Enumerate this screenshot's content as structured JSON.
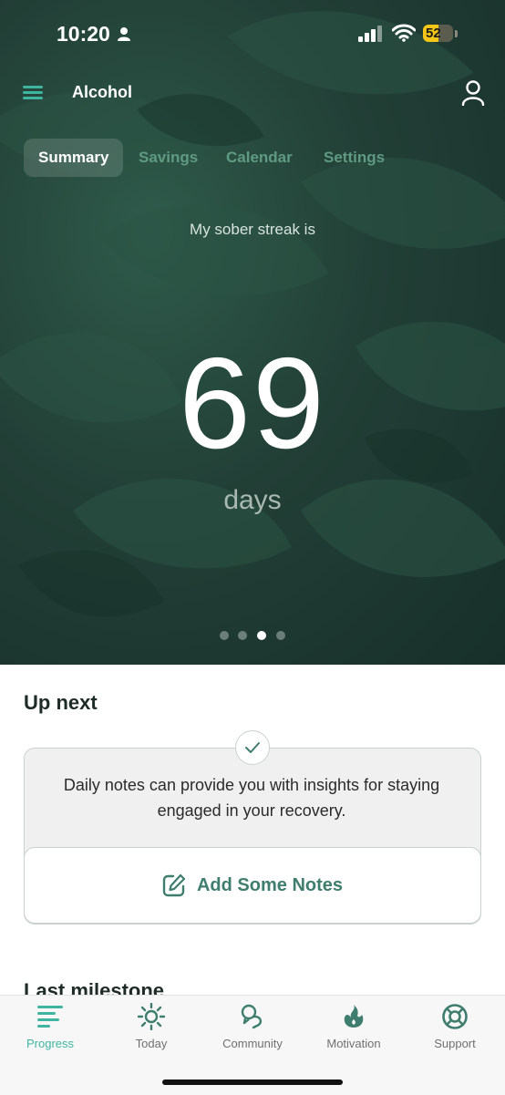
{
  "status_bar": {
    "time": "10:20",
    "battery": "52",
    "battery_level": 0.52
  },
  "header": {
    "title": "Alcohol"
  },
  "tabs": [
    {
      "label": "Summary",
      "active": true
    },
    {
      "label": "Savings",
      "active": false
    },
    {
      "label": "Calendar",
      "active": false
    },
    {
      "label": "Settings",
      "active": false
    }
  ],
  "streak": {
    "label": "My sober streak is",
    "value": "69",
    "unit": "days"
  },
  "carousel": {
    "count": 4,
    "active_index": 2
  },
  "up_next": {
    "title": "Up next",
    "description": "Daily notes can provide you with insights for staying engaged in your recovery.",
    "button_label": "Add Some Notes"
  },
  "last_milestone": {
    "title": "Last milestone"
  },
  "bottom_nav": [
    {
      "label": "Progress",
      "icon": "progress-icon",
      "active": true
    },
    {
      "label": "Today",
      "icon": "sun-icon",
      "active": false
    },
    {
      "label": "Community",
      "icon": "community-icon",
      "active": false
    },
    {
      "label": "Motivation",
      "icon": "flame-icon",
      "active": false
    },
    {
      "label": "Support",
      "icon": "lifebuoy-icon",
      "active": false
    }
  ],
  "colors": {
    "accent": "#3fb5a0",
    "button_text": "#3f7d6e",
    "hero_bg": "#223f36",
    "battery": "#f5c518"
  }
}
